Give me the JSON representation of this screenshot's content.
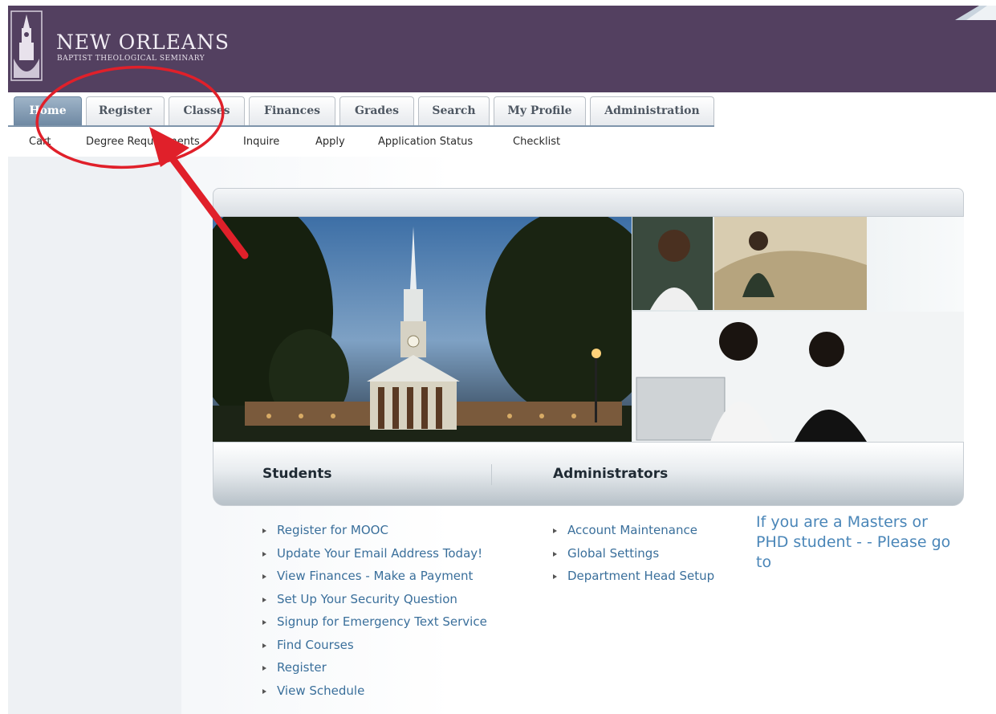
{
  "header": {
    "logo_name": "NEW ORLEANS",
    "logo_subtitle": "BAPTIST THEOLOGICAL SEMINARY",
    "brand_color": "#534060"
  },
  "tabs": [
    {
      "label": "Home",
      "active": true
    },
    {
      "label": "Register",
      "active": false
    },
    {
      "label": "Classes",
      "active": false
    },
    {
      "label": "Finances",
      "active": false
    },
    {
      "label": "Grades",
      "active": false
    },
    {
      "label": "Search",
      "active": false
    },
    {
      "label": "My Profile",
      "active": false
    },
    {
      "label": "Administration",
      "active": false
    }
  ],
  "subnav": [
    "Cart",
    "Degree Requirements",
    "Inquire",
    "Apply",
    "Application Status",
    "Checklist"
  ],
  "panel": {
    "students_heading": "Students",
    "admins_heading": "Administrators"
  },
  "students_links": [
    "Register for MOOC",
    "Update Your Email Address Today!",
    "View Finances - Make a Payment",
    "Set Up Your Security Question",
    "Signup for Emergency Text Service",
    "Find Courses",
    "Register",
    "View Schedule"
  ],
  "admin_links": [
    "Account Maintenance",
    "Global Settings",
    "Department Head Setup"
  ],
  "masters_note": "If you are a Masters or PHD student - - Please go to",
  "icons": {
    "logo": "chapel-steeple-logo-icon",
    "bullet": "triangle-bullet-icon",
    "annotation": "red-circle-arrow"
  },
  "colors": {
    "link": "#3a6f9b",
    "note": "#4a86b8",
    "annotation": "#e0202a",
    "active_tab": "#7f95ab"
  }
}
